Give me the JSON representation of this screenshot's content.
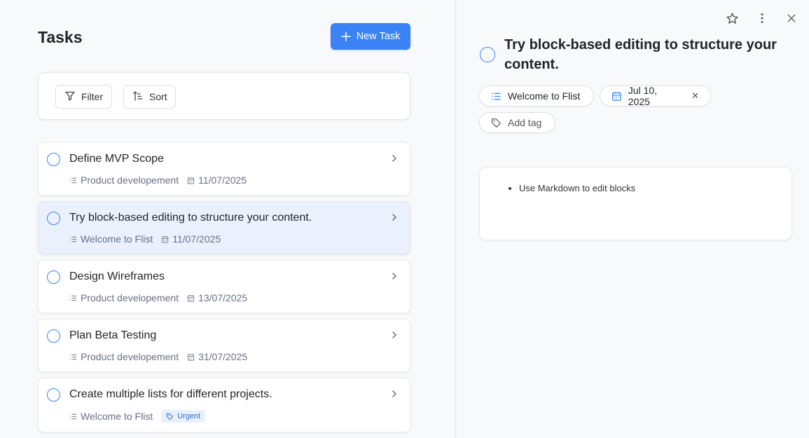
{
  "header": {
    "title": "Tasks",
    "new_task_label": "New Task"
  },
  "toolbar": {
    "filter_label": "Filter",
    "sort_label": "Sort"
  },
  "tasks": [
    {
      "title": "Define MVP Scope",
      "list": "Product developement",
      "date": "11/07/2025"
    },
    {
      "title": "Try block-based editing to structure your content.",
      "list": "Welcome to Flist",
      "date": "11/07/2025",
      "selected": true
    },
    {
      "title": "Design Wireframes",
      "list": "Product developement",
      "date": "13/07/2025"
    },
    {
      "title": "Plan Beta Testing",
      "list": "Product developement",
      "date": "31/07/2025"
    },
    {
      "title": "Create multiple lists for different projects.",
      "list": "Welcome to Flist",
      "tag": "Urgent"
    }
  ],
  "detail": {
    "title": "Try block-based editing to structure your content.",
    "list_chip": "Welcome to Flist",
    "date_chip": "Jul 10, 2025",
    "add_tag_label": "Add tag",
    "blocks": [
      "Use Markdown to edit blocks"
    ]
  },
  "colors": {
    "accent": "#3b82f6",
    "selected_row": "#eaf1fc",
    "tag_bg": "#e8f0fd"
  },
  "icons": {
    "new_task": "plus-icon",
    "filter": "filter-icon",
    "sort": "sort-icon",
    "row_list": "list-icon",
    "row_date": "calendar-icon",
    "row_tag": "tag-icon",
    "row_open": "chevron-right-icon",
    "favorite": "star-icon",
    "more": "more-vertical-icon",
    "close": "close-icon",
    "chip_list": "list-icon",
    "chip_date": "calendar-icon",
    "chip_date_clear": "clear-icon",
    "chip_add_tag": "tag-icon"
  }
}
